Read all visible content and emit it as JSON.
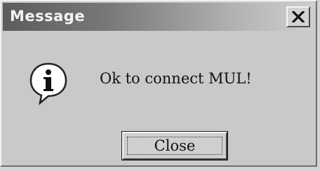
{
  "dialog": {
    "title": "Message",
    "message": "Ok to connect MUL!",
    "icon": "info-icon",
    "close_button_label": "Close",
    "titlebar_close_icon": "close-icon"
  }
}
